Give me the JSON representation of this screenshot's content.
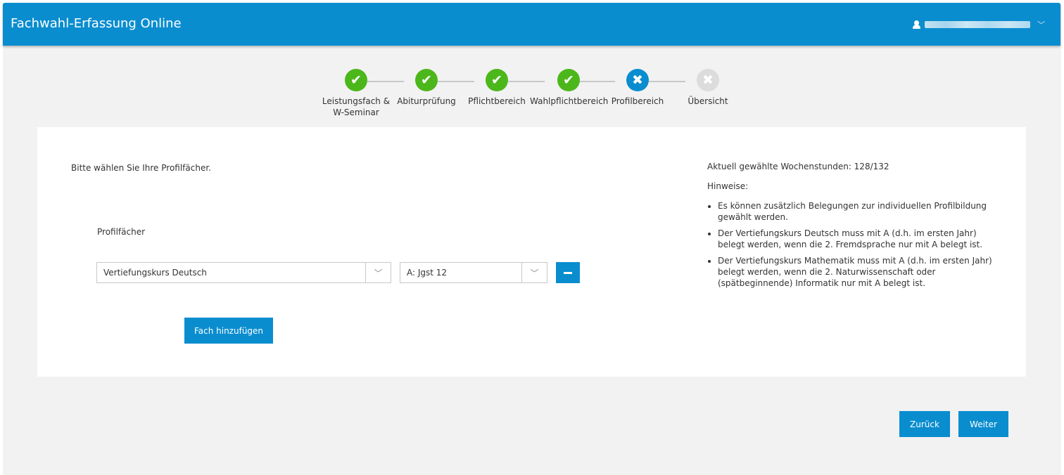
{
  "header": {
    "title": "Fachwahl-Erfassung Online",
    "user_icon": "user-icon",
    "dropdown_icon": "chevron-down-icon"
  },
  "stepper": {
    "steps": [
      {
        "label_line1": "Leistungsfach &",
        "label_line2": "W-Seminar",
        "state": "done",
        "icon": "check-icon"
      },
      {
        "label_line1": "Abiturprüfung",
        "label_line2": "",
        "state": "done",
        "icon": "check-icon"
      },
      {
        "label_line1": "Pflichtbereich",
        "label_line2": "",
        "state": "done",
        "icon": "check-icon"
      },
      {
        "label_line1": "Wahlpflichtbereich",
        "label_line2": "",
        "state": "done",
        "icon": "check-icon"
      },
      {
        "label_line1": "Profilbereich",
        "label_line2": "",
        "state": "current",
        "icon": "cross-icon"
      },
      {
        "label_line1": "Übersicht",
        "label_line2": "",
        "state": "future",
        "icon": "cross-icon"
      }
    ],
    "glyphs": {
      "check": "✔",
      "cross": "✖"
    }
  },
  "main": {
    "intro": "Bitte wählen Sie Ihre Profilfächer.",
    "field_label": "Profilfächer",
    "subject_select": {
      "value": "Vertiefungskurs Deutsch"
    },
    "grade_select": {
      "value": "A: Jgst 12"
    },
    "add_button": "Fach hinzufügen"
  },
  "side": {
    "hours": "Aktuell gewählte Wochenstunden: 128/132",
    "hints_title": "Hinweise:",
    "hints": [
      "Es können zusätzlich Belegungen zur individuellen Profilbildung gewählt werden.",
      "Der Vertiefungskurs Deutsch muss mit A (d.h. im ersten Jahr) belegt werden, wenn die 2. Fremdsprache nur mit A belegt ist.",
      "Der Vertiefungskurs Mathematik muss mit A (d.h. im ersten Jahr) belegt werden, wenn die 2. Naturwissenschaft oder (spätbeginnende) Informatik nur mit A belegt ist."
    ]
  },
  "footer": {
    "back_button": "Zurück",
    "next_button": "Weiter"
  },
  "colors": {
    "primary": "#0a8dcf",
    "done": "#4cb71b",
    "future": "#dcdcdc",
    "background": "#f2f2f2"
  }
}
